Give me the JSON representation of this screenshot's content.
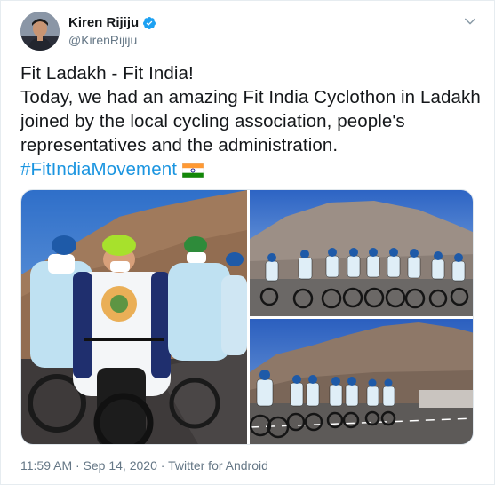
{
  "tweet": {
    "author_name": "Kiren Rijiju",
    "author_handle": "@KirenRijiju",
    "verified": true,
    "lines": [
      "Fit Ladakh - Fit India!",
      "Today, we had an amazing Fit India Cyclothon in Ladakh",
      "joined by the local cycling association, people's",
      "representatives and the administration."
    ],
    "hashtag": "#FitIndiaMovement",
    "flag_icon": "india-flag-icon",
    "timestamp": "11:59 AM · Sep 14, 2020",
    "separator": " · ",
    "source": "Twitter for Android"
  },
  "colors": {
    "text": "#14171a",
    "secondary": "#657786",
    "link": "#1b95e0",
    "verified": "#1da1f2"
  },
  "media": {
    "photo_count": 3
  }
}
